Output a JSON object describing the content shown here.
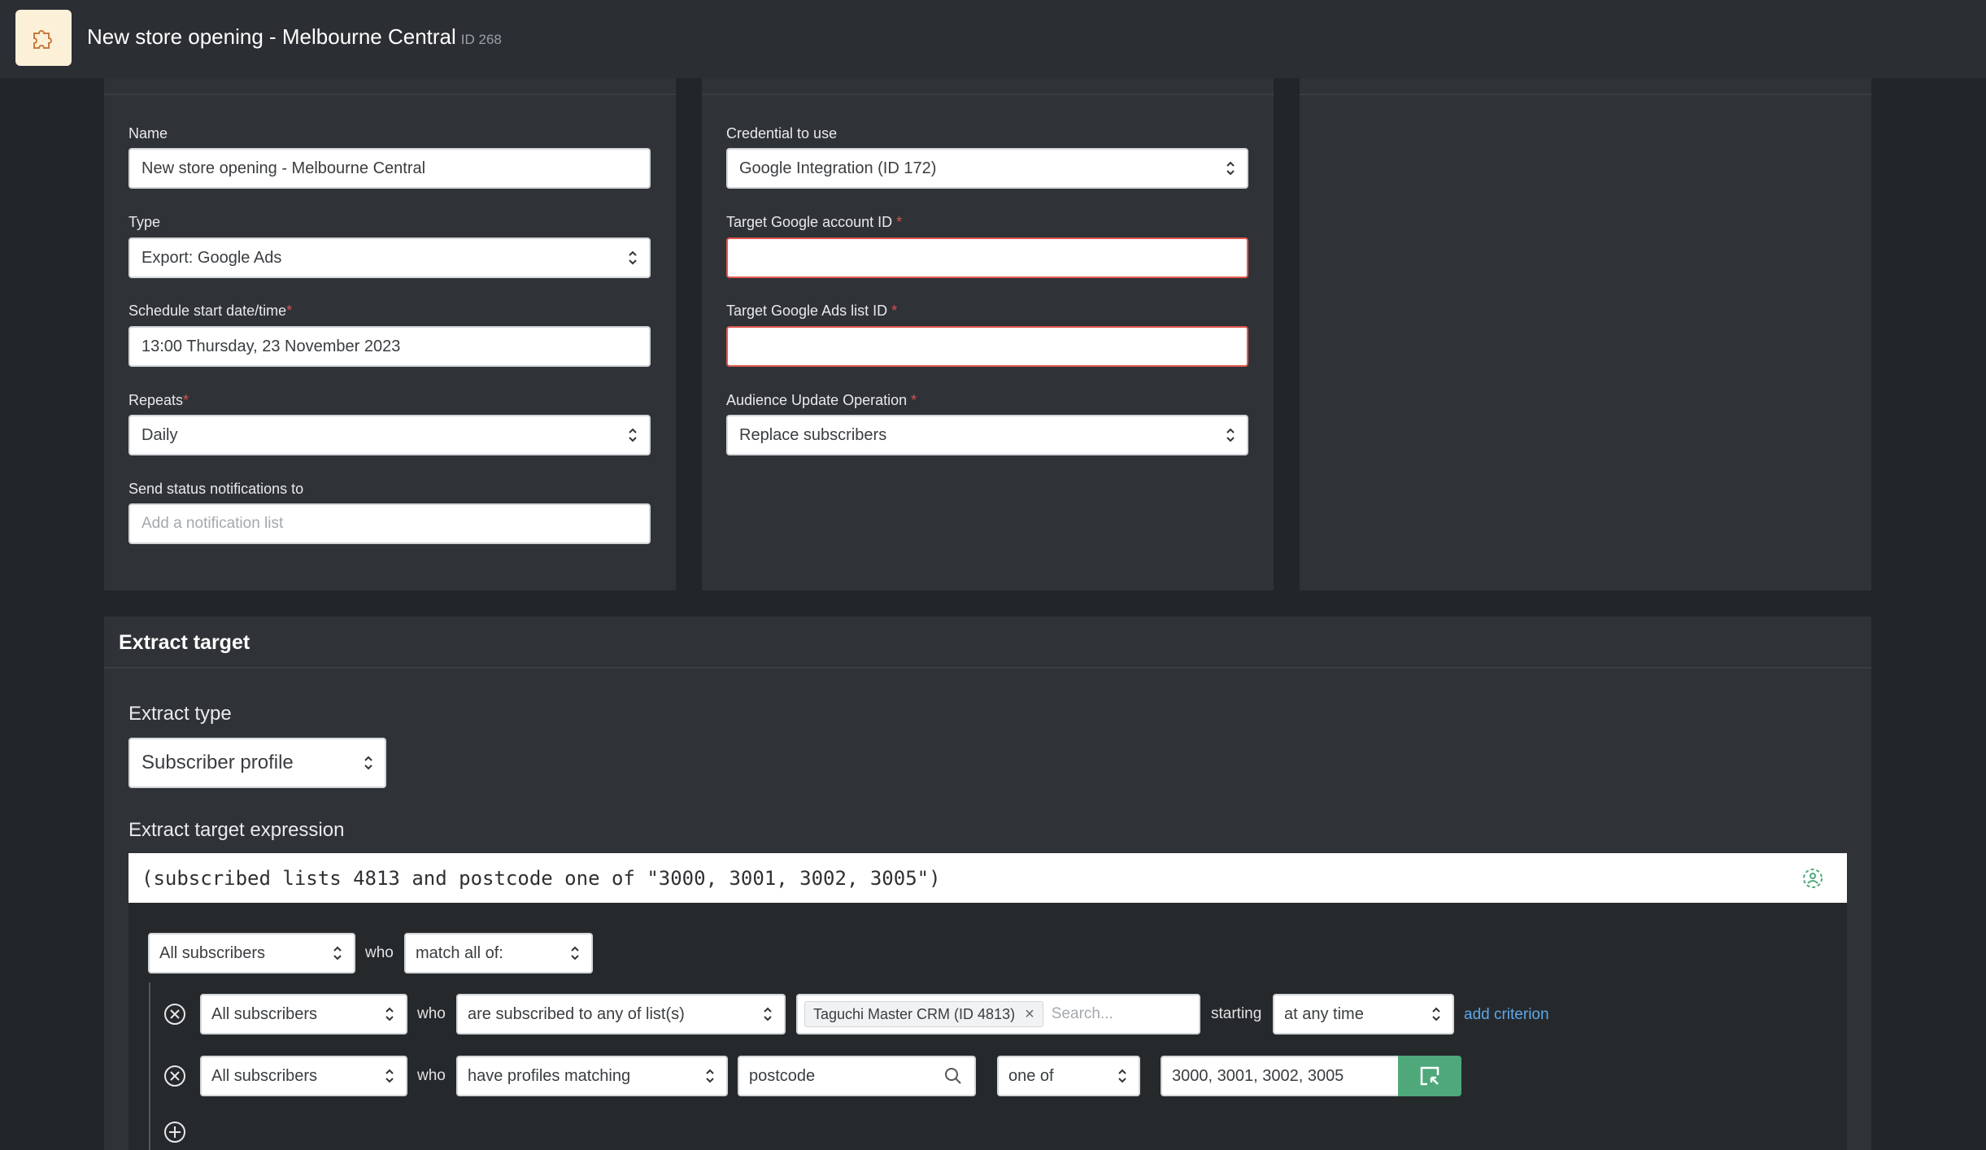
{
  "header": {
    "title": "New store opening - Melbourne Central",
    "id_label": "ID 268"
  },
  "general": {
    "name_label": "Name",
    "name_value": "New store opening - Melbourne Central",
    "type_label": "Type",
    "type_value": "Export: Google Ads",
    "schedule_label": "Schedule start date/time",
    "schedule_value": "13:00 Thursday, 23 November 2023",
    "repeats_label": "Repeats",
    "repeats_value": "Daily",
    "notify_label": "Send status notifications to",
    "notify_placeholder": "Add a notification list"
  },
  "integration": {
    "credential_label": "Credential to use",
    "credential_value": "Google Integration (ID 172)",
    "account_label": "Target Google account ID",
    "account_value": "",
    "list_label": "Target Google Ads list ID",
    "list_value": "",
    "operation_label": "Audience Update Operation",
    "operation_value": "Replace subscribers"
  },
  "required_marker": "*",
  "extract": {
    "title": "Extract target",
    "type_label": "Extract type",
    "type_value": "Subscriber profile",
    "expression_label": "Extract target expression",
    "expression": "(subscribed lists 4813 and postcode one of \"3000, 3001, 3002, 3005\")",
    "root": {
      "scope": "All subscribers",
      "who": "who",
      "match": "match all of:"
    },
    "criteria": [
      {
        "scope": "All subscribers",
        "who": "who",
        "condition": "are subscribed to any of list(s)",
        "chip": "Taguchi Master CRM (ID 4813)",
        "search_placeholder": "Search...",
        "starting_label": "starting",
        "time": "at any time",
        "add_link": "add criterion"
      },
      {
        "scope": "All subscribers",
        "who": "who",
        "condition": "have profiles matching",
        "field": "postcode",
        "operator": "one of",
        "value": "3000, 3001, 3002, 3005"
      }
    ]
  },
  "icons": {
    "logo": "puzzle-icon",
    "expression_helper": "people-gear-icon",
    "remove": "remove-circle-icon",
    "add": "add-circle-icon",
    "search": "search-icon",
    "pick": "cursor-select-icon"
  },
  "colors": {
    "accent_green": "#4ea87a",
    "error": "#e0584f",
    "link": "#5ea7e8"
  }
}
